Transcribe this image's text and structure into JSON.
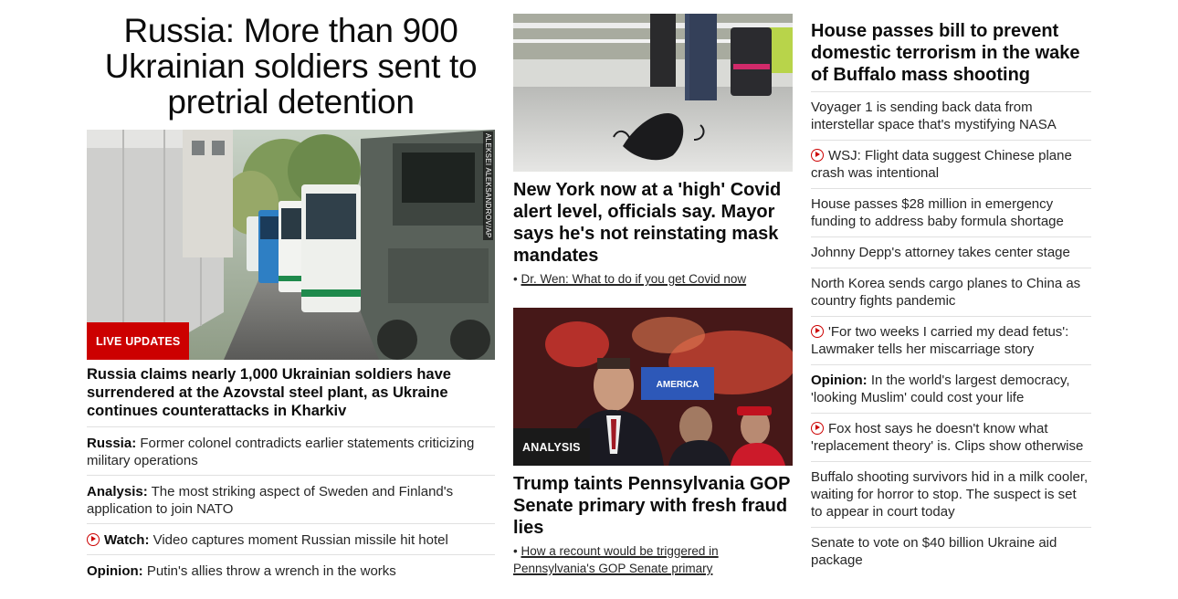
{
  "left": {
    "hero_title": "Russia: More than 900 Ukrainian soldiers sent to pretrial detention",
    "photo_badge": "LIVE UPDATES",
    "photo_credit": "ALEKSEI ALEKSANDROV/AP",
    "lead": "Russia claims nearly 1,000 Ukrainian soldiers have surrendered at the Azovstal steel plant, as Ukraine continues counterattacks in Kharkiv",
    "items": [
      {
        "prefix": "Russia:",
        "text": " Former colonel contradicts earlier statements criticizing military operations"
      },
      {
        "prefix": "Analysis:",
        "text": " The most striking aspect of Sweden and Finland's application to join NATO"
      },
      {
        "prefix": "Watch:",
        "text": " Video captures moment Russian missile hit hotel",
        "icon": "play-icon"
      },
      {
        "prefix": "Opinion:",
        "text": " Putin's allies throw a wrench in the works"
      }
    ]
  },
  "mid": {
    "story1": {
      "headline": "New York now at a 'high' Covid alert level, officials say. Mayor says he's not reinstating mask mandates",
      "sublink": "Dr. Wen: What to do if you get Covid now"
    },
    "story2": {
      "badge": "ANALYSIS",
      "sign_text": "AMERICA",
      "headline": "Trump taints Pennsylvania GOP Senate primary with fresh fraud lies",
      "sublink_line1": "How a recount would be triggered in",
      "sublink_line2": "Pennsylvania's GOP Senate primary"
    }
  },
  "right": {
    "headline": "House passes bill to prevent domestic terrorism in the wake of Buffalo mass shooting",
    "items": [
      {
        "text": "Voyager 1 is sending back data from interstellar space that's mystifying NASA"
      },
      {
        "text": "WSJ: Flight data suggest Chinese plane crash was intentional",
        "icon": "play-icon"
      },
      {
        "text": "House passes $28 million in emergency funding to address baby formula shortage"
      },
      {
        "text": "Johnny Depp's attorney takes center stage"
      },
      {
        "text": "North Korea sends cargo planes to China as country fights pandemic"
      },
      {
        "text": "'For two weeks I carried my dead fetus': Lawmaker tells her miscarriage story",
        "icon": "play-icon"
      },
      {
        "prefix": "Opinion:",
        "text": " In the world's largest democracy, 'looking Muslim' could cost your life"
      },
      {
        "text": "Fox host says he doesn't know what 'replacement theory' is. Clips show otherwise",
        "icon": "play-icon"
      },
      {
        "text": "Buffalo shooting survivors hid in a milk cooler, waiting for horror to stop. The suspect is set to appear in court today"
      },
      {
        "text": "Senate to vote on $40 billion Ukraine aid package"
      }
    ]
  },
  "colors": {
    "accent_red": "#cc0000",
    "text": "#0c0c0c",
    "divider": "#e0e0e0"
  }
}
